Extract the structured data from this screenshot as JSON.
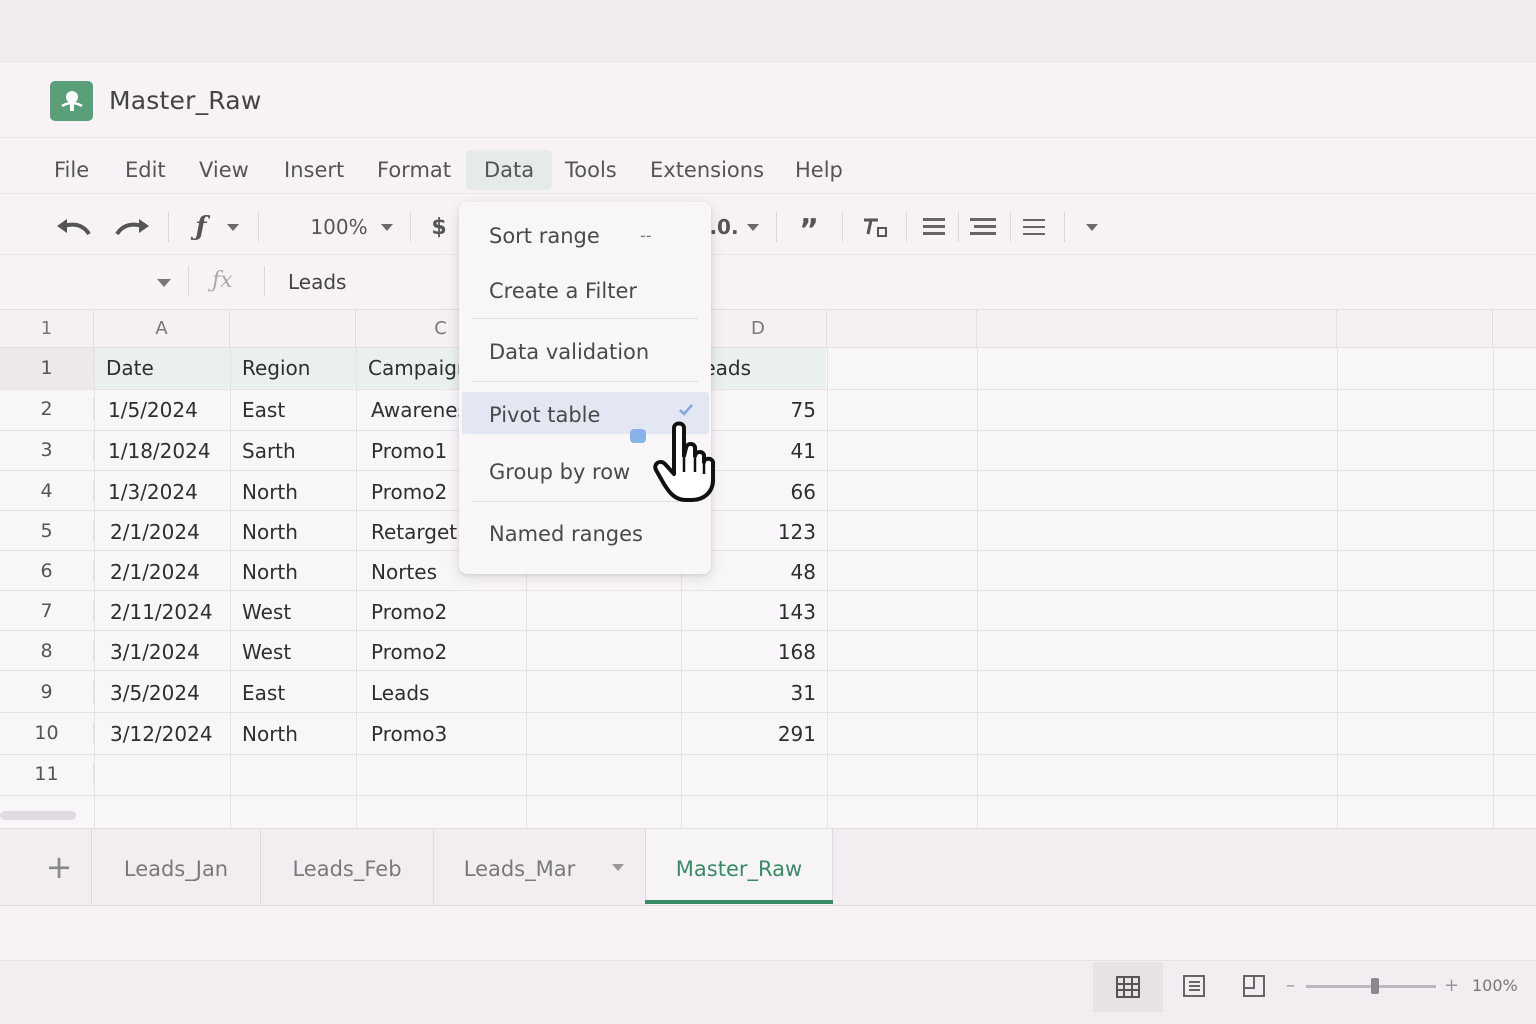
{
  "app": {
    "doc_title": "Master_Raw",
    "logo_icon": "sheets-logo-icon",
    "accent_color": "#3a8a66"
  },
  "menu": {
    "file": "File",
    "edit": "Edit",
    "view": "View",
    "insert": "Insert",
    "format": "Format",
    "data": "Data",
    "tools": "Tools",
    "extensions": "Extensions",
    "help": "Help",
    "active": "Data"
  },
  "toolbar": {
    "zoom": "100%",
    "currency": "$",
    "decimal": ".0.",
    "quote": "”"
  },
  "formula_bar": {
    "value": "Leads"
  },
  "columns": {
    "a": "A",
    "c": "C",
    "d": "D"
  },
  "row_numbers": [
    "1",
    "1",
    "2",
    "3",
    "4",
    "5",
    "6",
    "7",
    "8",
    "9",
    "10",
    "11"
  ],
  "table": {
    "headers": {
      "date": "Date",
      "region": "Region",
      "campaign": "Campaign",
      "leads": "Leads"
    },
    "rows": [
      {
        "date": "1/5/2024",
        "region": "East",
        "campaign": "Awareness",
        "leads": "75"
      },
      {
        "date": "1/18/2024",
        "region": "Sarth",
        "campaign": "Promo1",
        "leads": "41"
      },
      {
        "date": "1/3/2024",
        "region": "North",
        "campaign": "Promo2",
        "leads": "66"
      },
      {
        "date": "2/1/2024",
        "region": "North",
        "campaign": "Retargeting",
        "leads": "123"
      },
      {
        "date": "2/1/2024",
        "region": "North",
        "campaign": "Nortes",
        "leads": "48"
      },
      {
        "date": "2/11/2024",
        "region": "West",
        "campaign": "Promo2",
        "leads": "143"
      },
      {
        "date": "3/1/2024",
        "region": "West",
        "campaign": "Promo2",
        "leads": "168"
      },
      {
        "date": "3/5/2024",
        "region": "East",
        "campaign": "Leads",
        "leads": "31"
      },
      {
        "date": "3/12/2024",
        "region": "North",
        "campaign": "Promo3",
        "leads": "291"
      }
    ]
  },
  "data_menu": {
    "sort_range": "Sort range",
    "sort_shortcut": "--",
    "create_filter": "Create a Filter",
    "data_validation": "Data validation",
    "pivot_table": "Pivot table",
    "group_by_row": "Group by row",
    "named_ranges": "Named ranges",
    "highlighted": "Pivot table"
  },
  "sheets": {
    "tabs": [
      "Leads_Jan",
      "Leads_Feb",
      "Leads_Mar",
      "Master_Raw"
    ],
    "active": "Master_Raw"
  },
  "status": {
    "zoom": "100%",
    "zoom_minus": "–",
    "zoom_plus": "+"
  }
}
